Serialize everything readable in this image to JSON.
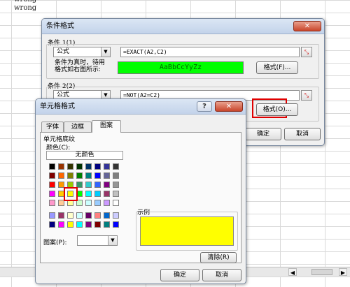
{
  "sheet": {
    "cells": [
      "wrong",
      "wrong"
    ]
  },
  "cf_dialog": {
    "title": "条件格式",
    "close": "✕",
    "cond1": {
      "label": "条件 1(1)",
      "type": "公式",
      "formula": "=EXACT(A2,C2)",
      "preview_label_line1": "条件为真时，待用",
      "preview_label_line2": "格式如右图所示:",
      "preview_text": "AaBbCcYyZz",
      "preview_color": "#00ff00",
      "format_button": "格式(F)..."
    },
    "cond2": {
      "label": "条件 2(2)",
      "type": "公式",
      "formula": "=NOT(A2=C2)",
      "format_button": "格式(O)..."
    },
    "ok_button": "确定",
    "cancel_button": "取消"
  },
  "cell_format_dialog": {
    "title": "单元格格式",
    "help": "?",
    "close": "✕",
    "tabs": [
      "字体",
      "边框",
      "图案"
    ],
    "group_label": "单元格底纹",
    "color_label": "颜色(C):",
    "no_color": "无颜色",
    "sample_label": "示例",
    "sample_color": "#ffff00",
    "pattern_label": "图案(P):",
    "clear_button": "清除(R)",
    "ok_button": "确定",
    "cancel_button": "取消",
    "palette_rows": [
      [
        "#000000",
        "#993300",
        "#333300",
        "#003300",
        "#003366",
        "#000080",
        "#333399",
        "#333333"
      ],
      [
        "#800000",
        "#ff6600",
        "#808000",
        "#008000",
        "#008080",
        "#0000ff",
        "#666699",
        "#808080"
      ],
      [
        "#ff0000",
        "#ff9900",
        "#99cc00",
        "#339966",
        "#33cccc",
        "#3366ff",
        "#800080",
        "#969696"
      ],
      [
        "#ff00ff",
        "#ffcc00",
        "#ffff00",
        "#00ff00",
        "#00ffff",
        "#00ccff",
        "#993366",
        "#c0c0c0"
      ],
      [
        "#ff99cc",
        "#ffcc99",
        "#ffff99",
        "#ccffcc",
        "#ccffff",
        "#99ccff",
        "#cc99ff",
        "#ffffff"
      ]
    ],
    "palette_extra_rows": [
      [
        "#9999ff",
        "#993366",
        "#ffffcc",
        "#ccffff",
        "#660066",
        "#ff8080",
        "#0066cc",
        "#ccccff"
      ],
      [
        "#000080",
        "#ff00ff",
        "#ffff00",
        "#00ffff",
        "#800080",
        "#800000",
        "#008080",
        "#0000ff"
      ]
    ]
  }
}
